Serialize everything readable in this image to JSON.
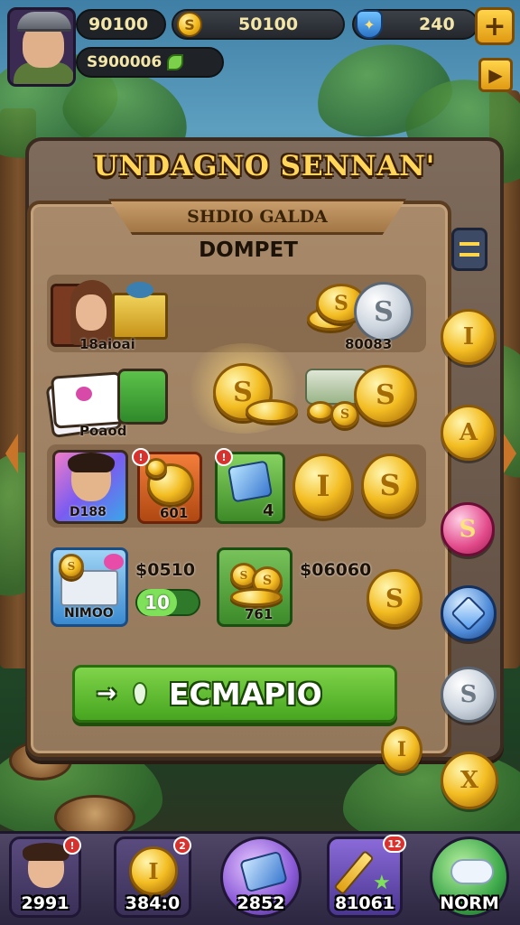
{
  "hud": {
    "player_gold": "90100",
    "player_cash": "S900006",
    "coins_total": "50100",
    "gems_total": "240",
    "coin_symbol": "S",
    "plus_symbol": "+",
    "arrow_symbol": "▶"
  },
  "panel": {
    "title": "UNDAGNO SENNAN'",
    "banner": "SHDIO GALDA",
    "subtitle": "DOMPET"
  },
  "items": {
    "character_chest_label": "18aioai",
    "coin_stack_value": "80083",
    "cards_label": "Poaod",
    "hero_card_label": "D188",
    "coin_card_value": "601",
    "gem_card_value": "4",
    "cash_bundle_label": "NIMOO",
    "price_a": "$0510",
    "price_b": "$06060",
    "toggle_value": "10",
    "gold_pile_value": "761",
    "coin_glyph_s": "S",
    "coin_glyph_i": "I",
    "coin_glyph_a": "A",
    "coin_glyph_x": "X"
  },
  "action_button": {
    "label": "ECMAPIO",
    "icon": "→"
  },
  "bottom_nav": [
    {
      "label": "2991",
      "badge": "!"
    },
    {
      "label": "384:0",
      "badge": "2"
    },
    {
      "label": "2852",
      "badge": ""
    },
    {
      "label": "81061",
      "badge": "12"
    },
    {
      "label": "NORM",
      "badge": ""
    }
  ]
}
